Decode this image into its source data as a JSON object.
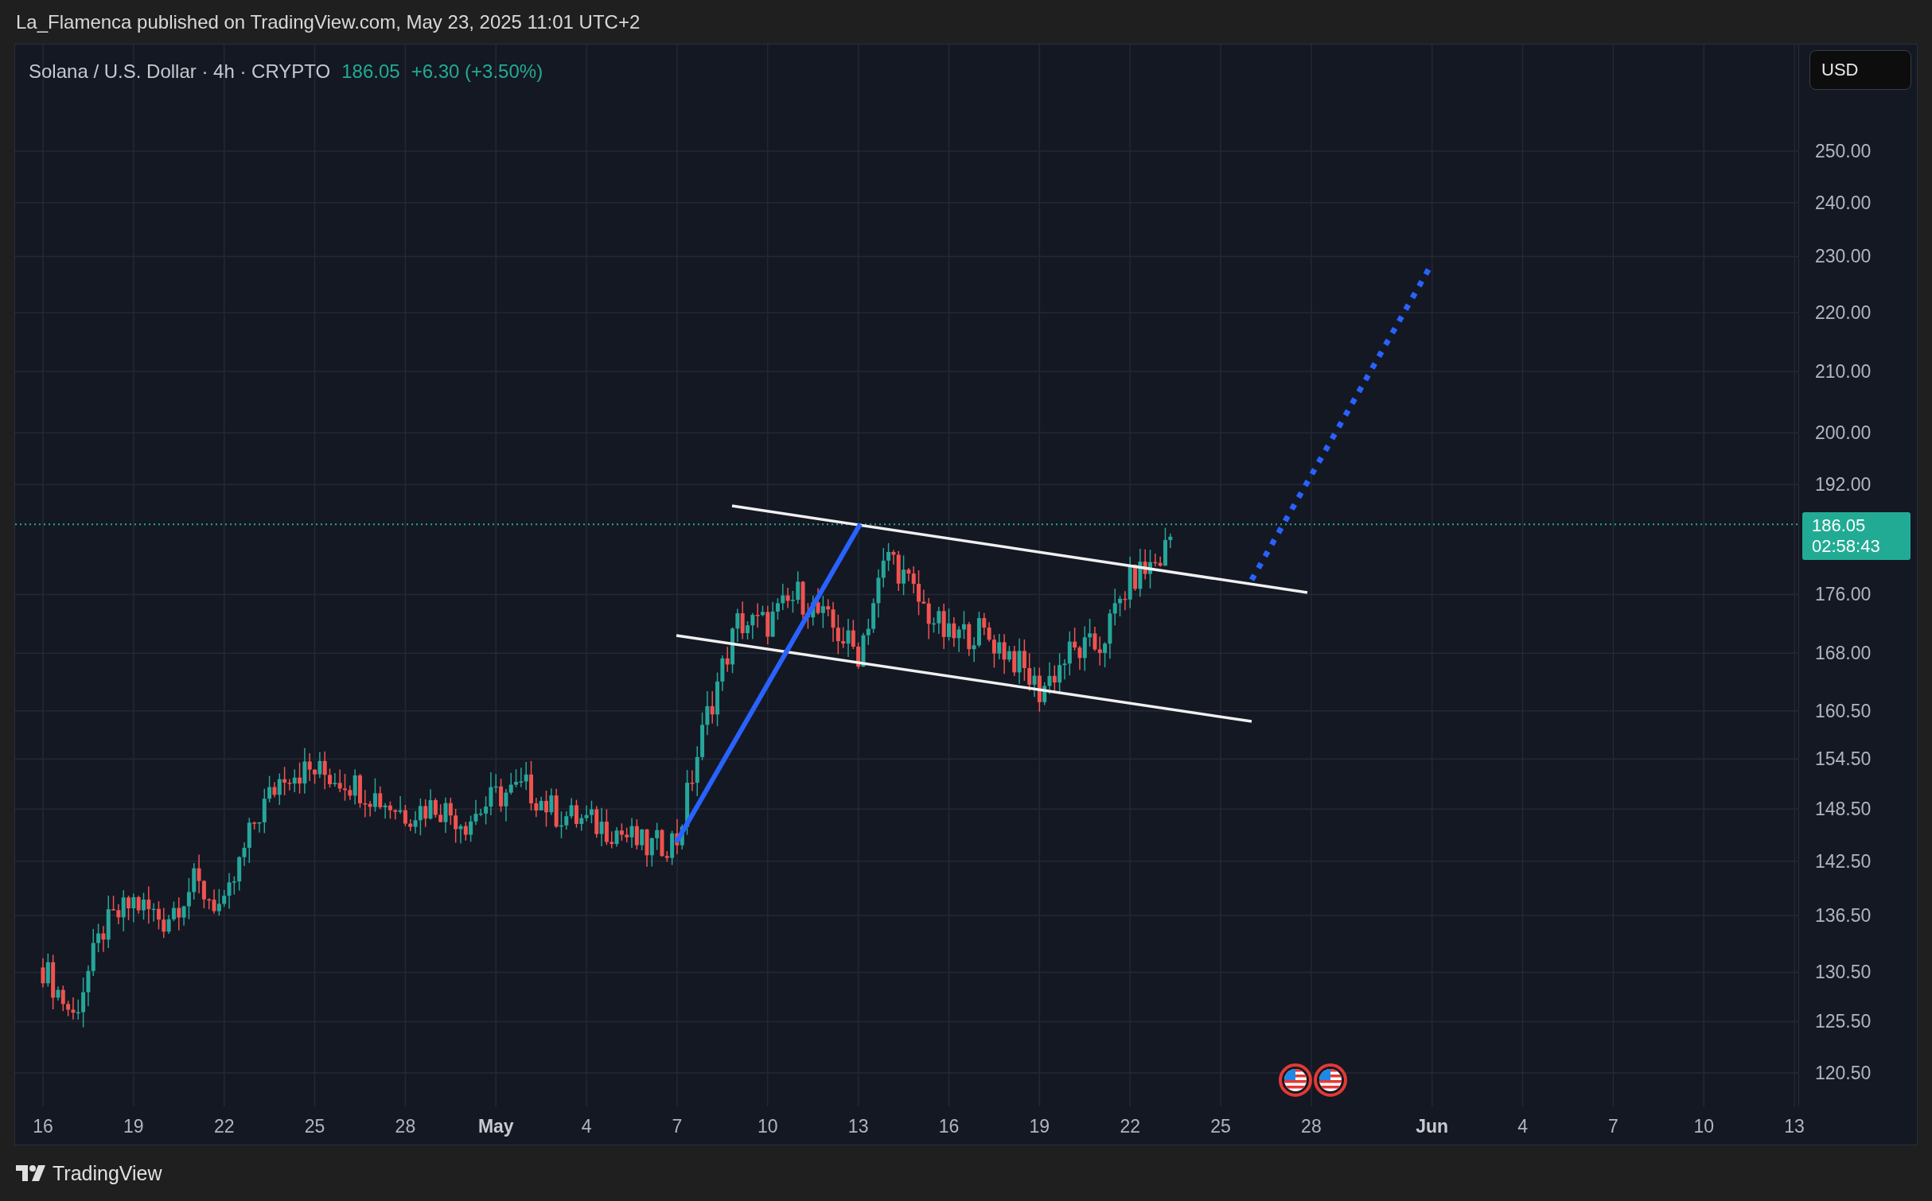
{
  "header": {
    "title": "La_Flamenca published on TradingView.com, May 23, 2025 11:01 UTC+2"
  },
  "legend": {
    "symbol": "Solana / U.S. Dollar · 4h · CRYPTO",
    "price": "186.05",
    "change": "+6.30 (+3.50%)"
  },
  "currency_button": "USD",
  "price_axis": {
    "labels": [
      "250.00",
      "240.00",
      "230.00",
      "220.00",
      "210.00",
      "200.00",
      "192.00",
      "176.00",
      "168.00",
      "160.50",
      "154.50",
      "148.50",
      "142.50",
      "136.50",
      "130.50",
      "125.50",
      "120.50"
    ]
  },
  "price_badge": {
    "price": "186.05",
    "countdown": "02:58:43"
  },
  "time_axis": {
    "labels": [
      {
        "text": "16",
        "kind": "day"
      },
      {
        "text": "19",
        "kind": "day"
      },
      {
        "text": "22",
        "kind": "day"
      },
      {
        "text": "25",
        "kind": "day"
      },
      {
        "text": "28",
        "kind": "day"
      },
      {
        "text": "May",
        "kind": "month"
      },
      {
        "text": "4",
        "kind": "day"
      },
      {
        "text": "7",
        "kind": "day"
      },
      {
        "text": "10",
        "kind": "day"
      },
      {
        "text": "13",
        "kind": "day"
      },
      {
        "text": "16",
        "kind": "day"
      },
      {
        "text": "19",
        "kind": "day"
      },
      {
        "text": "22",
        "kind": "day"
      },
      {
        "text": "25",
        "kind": "day"
      },
      {
        "text": "28",
        "kind": "day"
      },
      {
        "text": "Jun",
        "kind": "month"
      },
      {
        "text": "4",
        "kind": "day"
      },
      {
        "text": "7",
        "kind": "day"
      },
      {
        "text": "10",
        "kind": "day"
      },
      {
        "text": "13",
        "kind": "day"
      }
    ]
  },
  "footer": {
    "brand": "TradingView"
  }
}
